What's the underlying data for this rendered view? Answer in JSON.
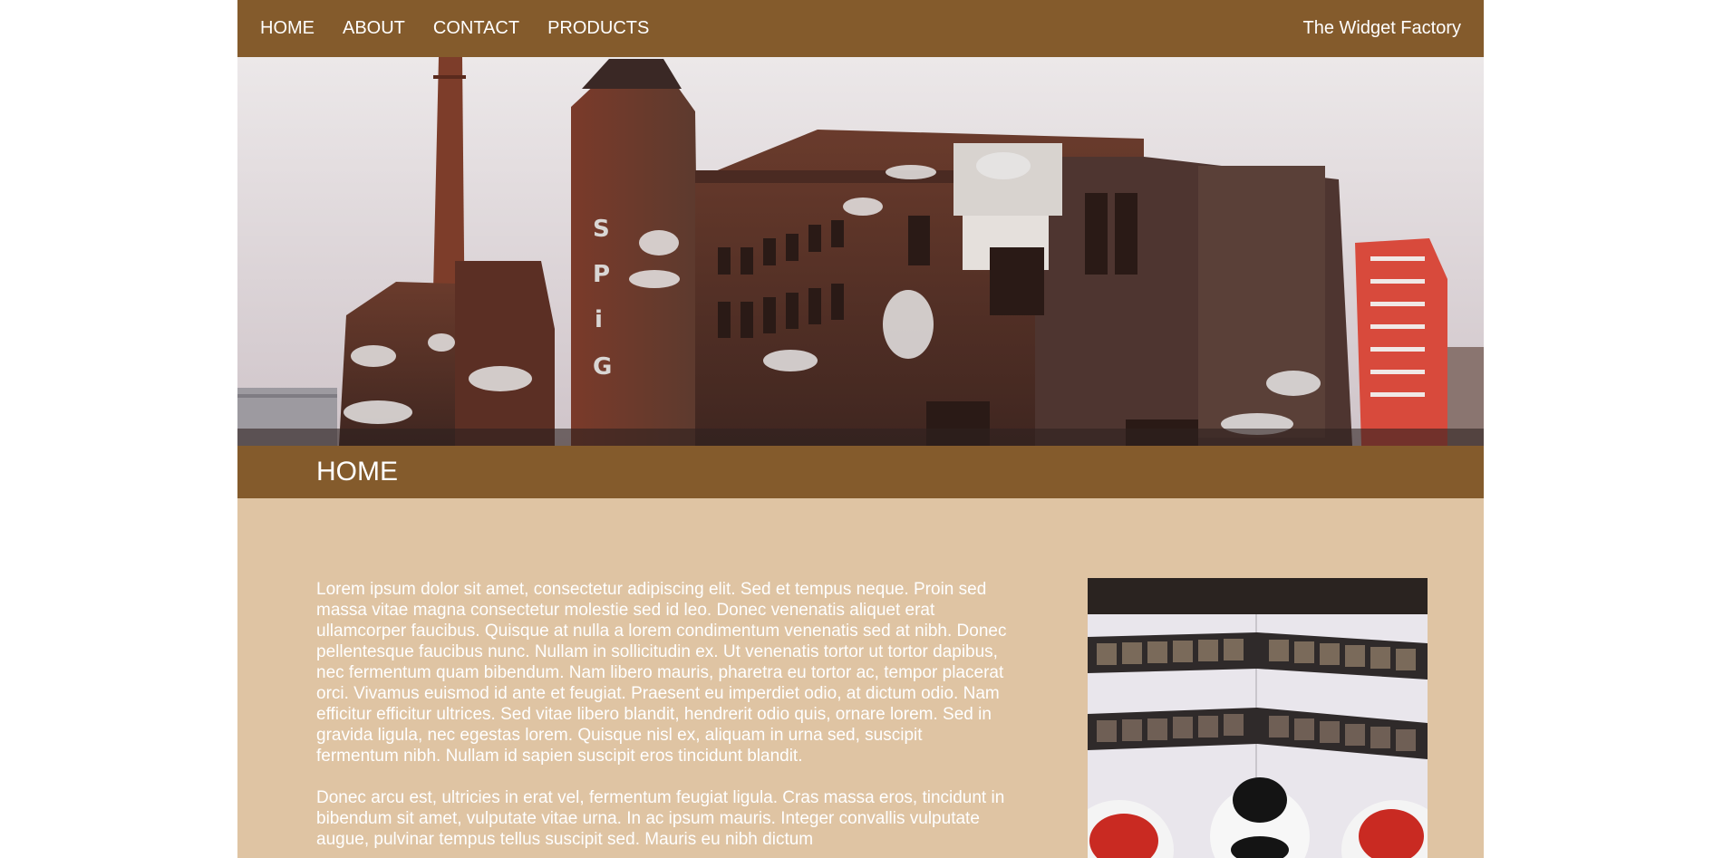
{
  "nav": {
    "items": [
      {
        "label": "HOME"
      },
      {
        "label": "ABOUT"
      },
      {
        "label": "CONTACT"
      },
      {
        "label": "PRODUCTS"
      }
    ],
    "site_title": "The Widget Factory"
  },
  "page": {
    "title": "HOME"
  },
  "content": {
    "paragraphs": [
      "Lorem ipsum dolor sit amet, consectetur adipiscing elit. Sed et tempus neque. Proin sed massa vitae magna consectetur molestie sed id leo. Donec venenatis aliquet erat ullamcorper faucibus. Quisque at nulla a lorem condimentum venenatis sed at nibh. Donec pellentesque faucibus nunc. Nullam in sollicitudin ex. Ut venenatis tortor ut tortor dapibus, nec fermentum quam bibendum. Nam libero mauris, pharetra eu tortor ac, tempor placerat orci. Vivamus euismod id ante et feugiat. Praesent eu imperdiet odio, at dictum odio. Nam efficitur efficitur ultrices. Sed vitae libero blandit, hendrerit odio quis, ornare lorem. Sed in gravida ligula, nec egestas lorem. Quisque nisl ex, aliquam in urna sed, suscipit fermentum nibh. Nullam id sapien suscipit eros tincidunt blandit.",
      "Donec arcu est, ultricies in erat vel, fermentum feugiat ligula. Cras massa eros, tincidunt in bibendum sit amet, vulputate vitae urna. In ac ipsum mauris. Integer convallis vulputate augue, pulvinar tempus tellus suscipit sed. Mauris eu nibh dictum"
    ]
  },
  "colors": {
    "header_brown": "#845b2c",
    "content_tan": "#dfc4a3",
    "text": "#ffffff"
  }
}
